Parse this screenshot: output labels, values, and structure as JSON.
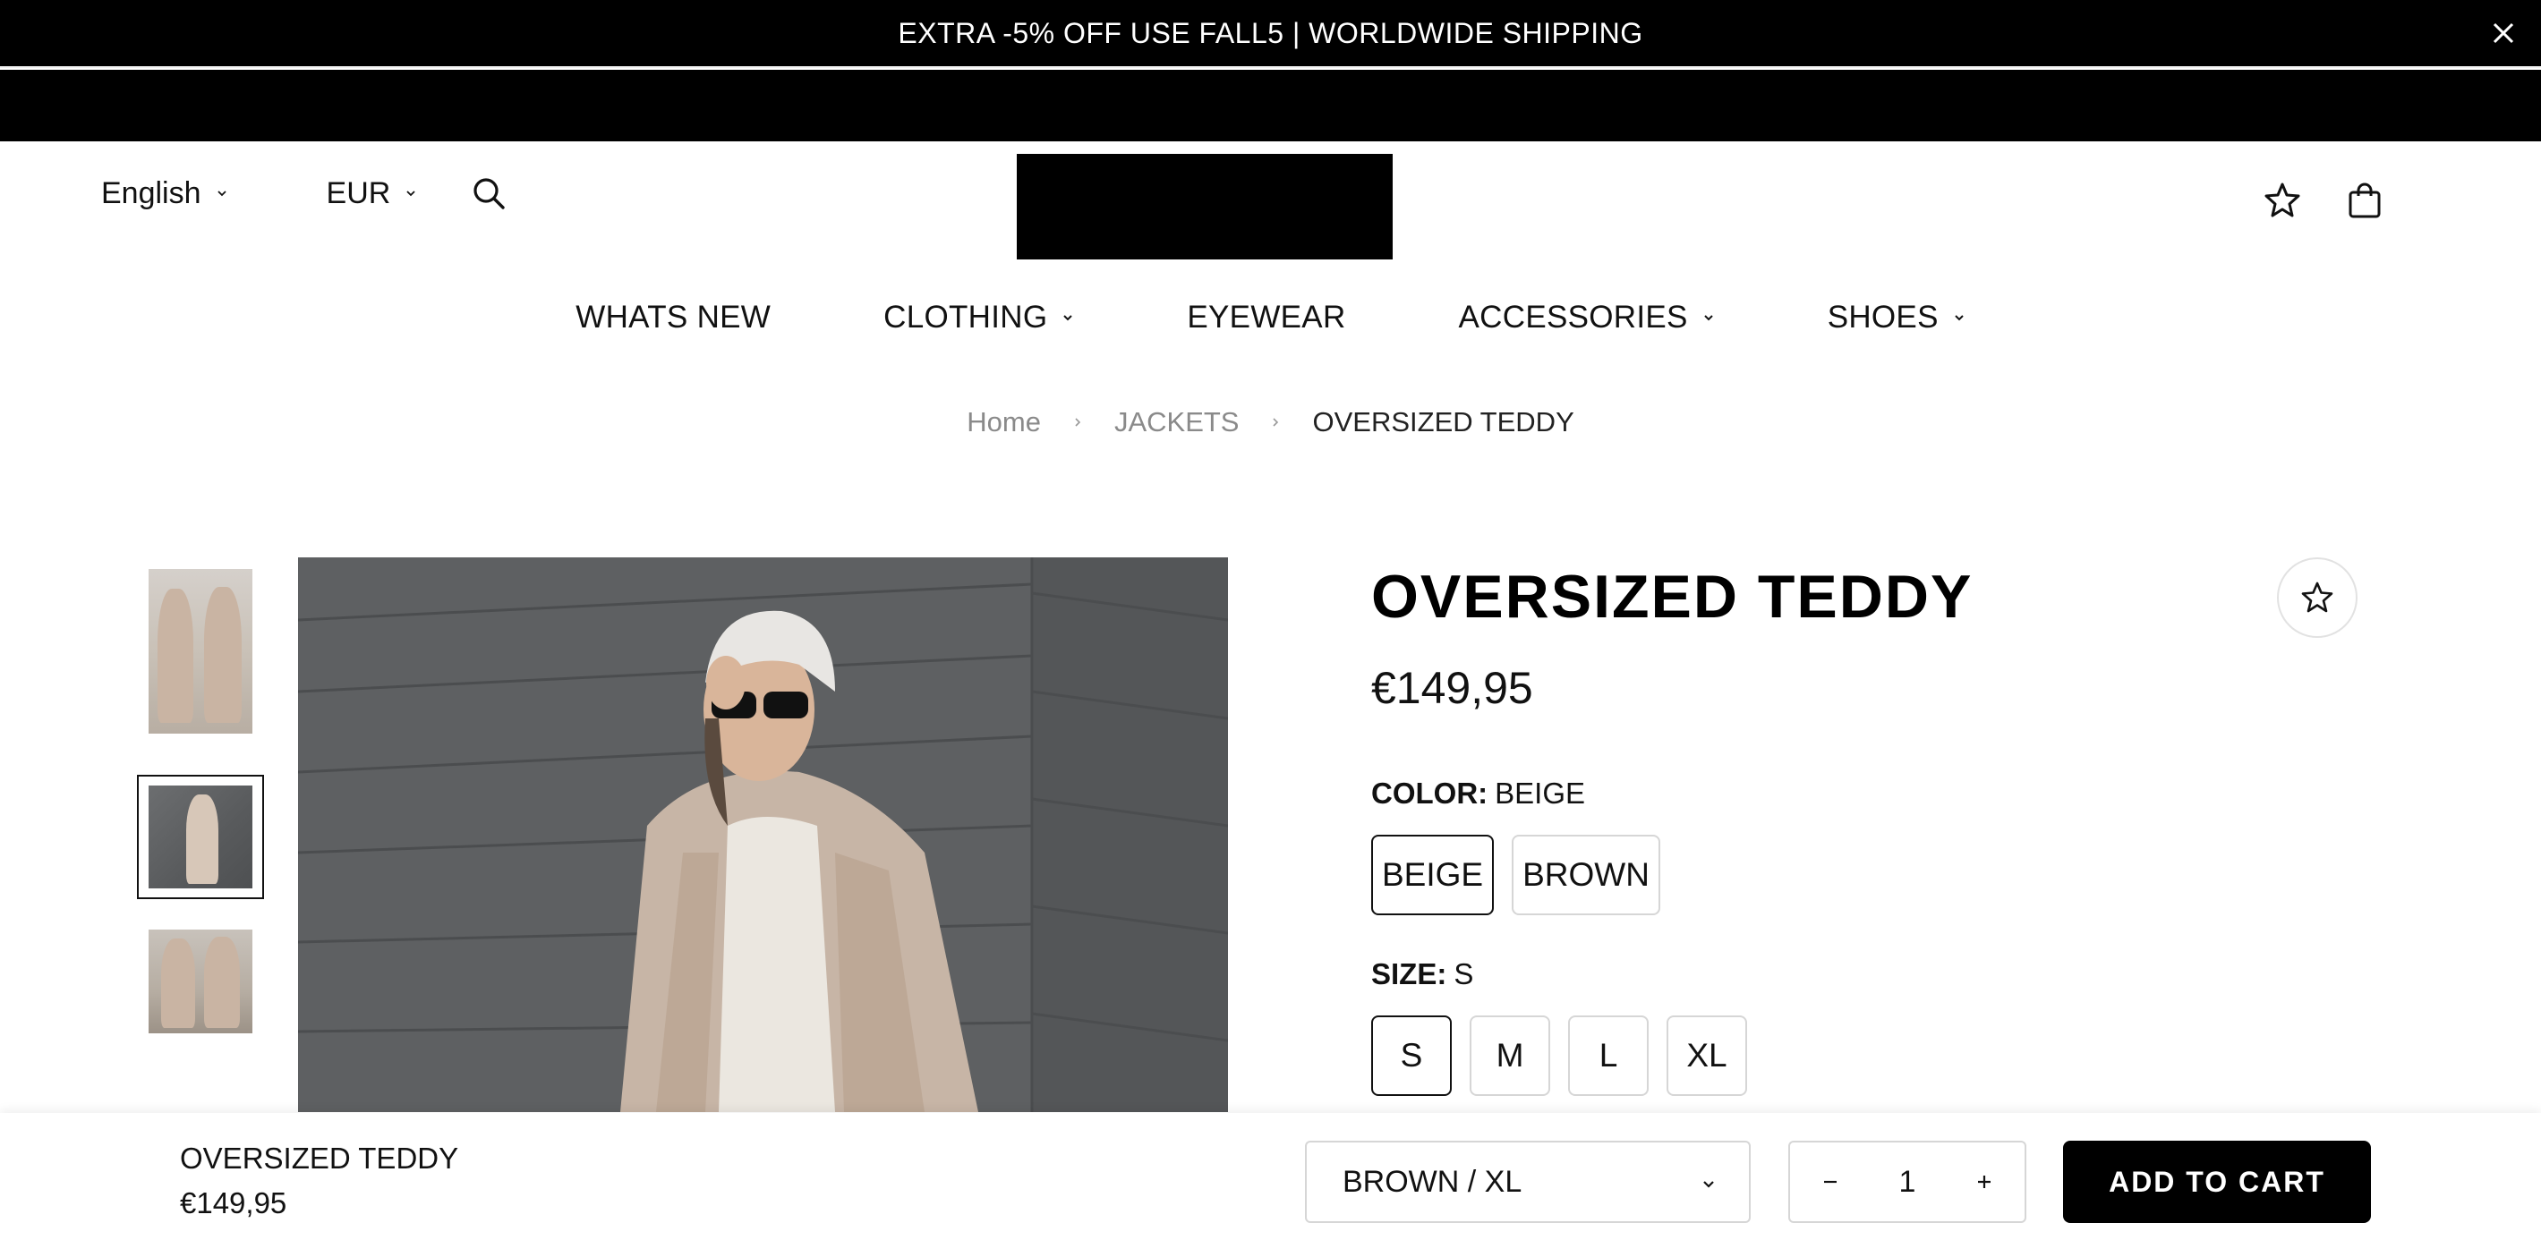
{
  "announcement": {
    "text": "EXTRA -5% OFF USE FALL5 | WORLDWIDE SHIPPING",
    "close_icon": "close-icon"
  },
  "header": {
    "language": "English",
    "currency": "EUR",
    "icons": [
      "search-icon",
      "star-icon",
      "shopping-bag-icon"
    ]
  },
  "nav": {
    "items": [
      {
        "label": "WHATS NEW",
        "has_dropdown": false
      },
      {
        "label": "CLOTHING",
        "has_dropdown": true
      },
      {
        "label": "EYEWEAR",
        "has_dropdown": false
      },
      {
        "label": "ACCESSORIES",
        "has_dropdown": true
      },
      {
        "label": "SHOES",
        "has_dropdown": true
      }
    ]
  },
  "breadcrumb": {
    "items": [
      "Home",
      "JACKETS"
    ],
    "current": "OVERSIZED TEDDY"
  },
  "gallery": {
    "thumbnail_count": 3,
    "selected_thumbnail": 2
  },
  "product": {
    "title": "OVERSIZED TEDDY",
    "price": "€149,95",
    "color": {
      "label": "COLOR:",
      "selected": "BEIGE",
      "options": [
        "BEIGE",
        "BROWN"
      ]
    },
    "size": {
      "label": "SIZE:",
      "selected": "S",
      "options": [
        "S",
        "M",
        "L",
        "XL"
      ]
    }
  },
  "sticky_bar": {
    "name": "OVERSIZED TEDDY",
    "price": "€149,95",
    "variant": "BROWN / XL",
    "quantity": "1",
    "add_to_cart": "ADD TO CART"
  },
  "colors": {
    "announcement_bg": "#000000",
    "text": "#111111",
    "muted": "#8a8a8a",
    "button_bg": "#000000"
  }
}
